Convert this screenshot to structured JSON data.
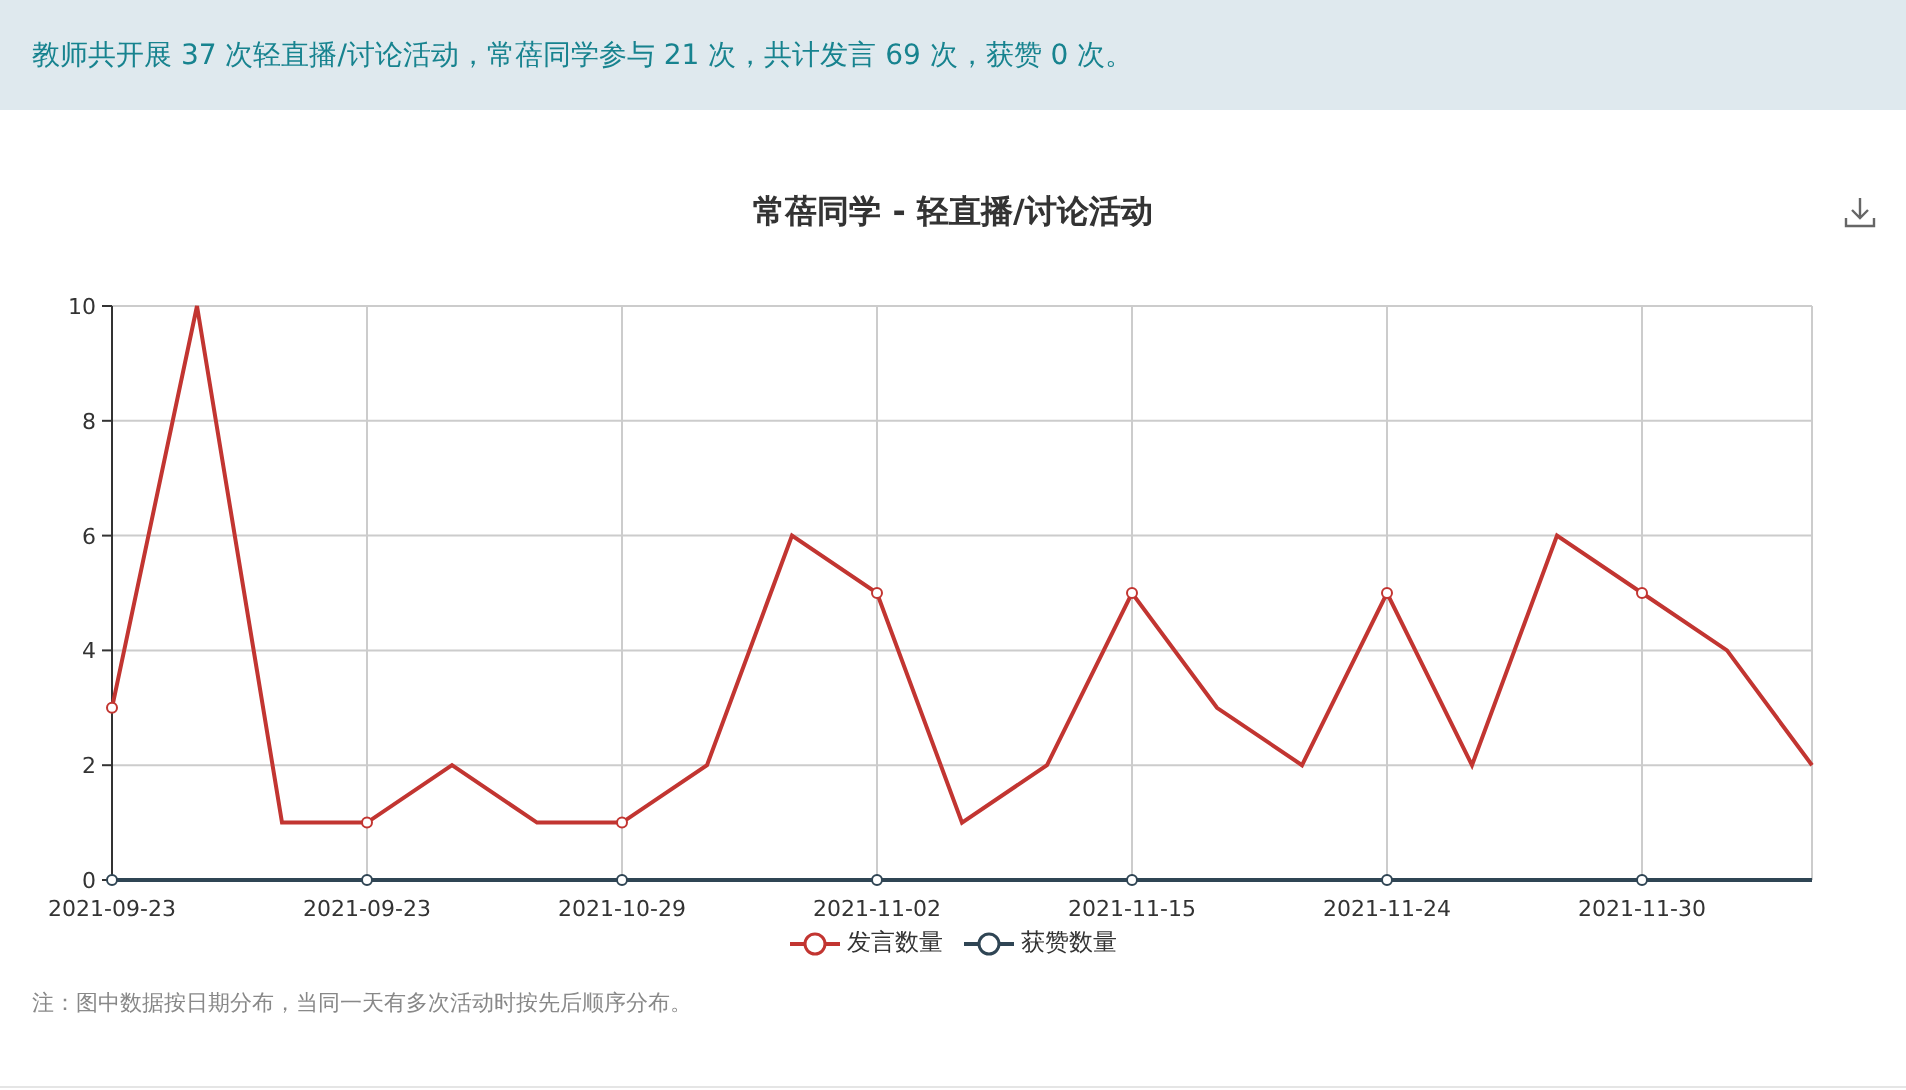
{
  "summary": "教师共开展 37 次轻直播/讨论活动，常蓓同学参与 21 次，共计发言 69 次，获赞 0 次。",
  "chart": {
    "chart_data": {
      "type": "line",
      "title": "常蓓同学 - 轻直播/讨论活动",
      "categories": [
        "2021-09-23",
        null,
        null,
        "2021-09-23",
        null,
        null,
        "2021-10-29",
        null,
        null,
        "2021-11-02",
        null,
        null,
        "2021-11-15",
        null,
        null,
        "2021-11-24",
        null,
        null,
        "2021-11-30",
        null,
        null
      ],
      "grid": true,
      "ylim": [
        0,
        10
      ],
      "yticks": [
        0,
        2,
        4,
        6,
        8,
        10
      ],
      "series": [
        {
          "name": "发言数量",
          "color": "#c23531",
          "values": [
            3,
            10,
            1,
            1,
            2,
            1,
            1,
            2,
            6,
            5,
            1,
            2,
            5,
            3,
            2,
            5,
            2,
            6,
            5,
            4,
            2
          ]
        },
        {
          "name": "获赞数量",
          "color": "#2f4554",
          "values": [
            0,
            0,
            0,
            0,
            0,
            0,
            0,
            0,
            0,
            0,
            0,
            0,
            0,
            0,
            0,
            0,
            0,
            0,
            0,
            0,
            0
          ]
        }
      ]
    }
  },
  "note": "注：图中数据按日期分布，当同一天有多次活动时按先后顺序分布。"
}
